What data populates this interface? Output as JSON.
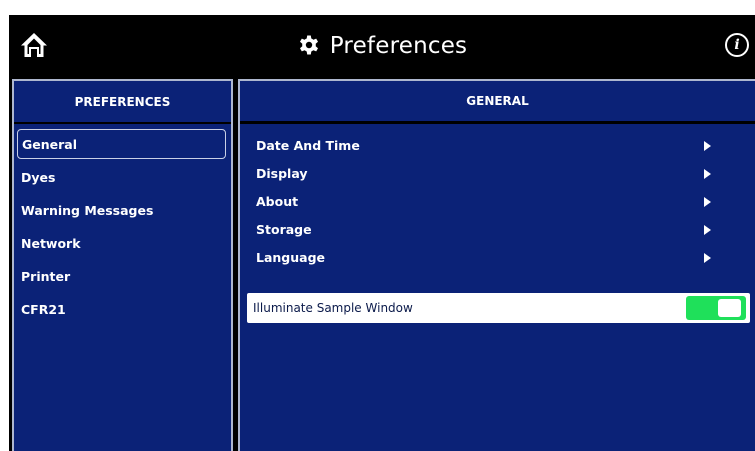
{
  "header": {
    "title": "Preferences",
    "home_icon": "home-icon",
    "settings_icon": "gear-icon",
    "info_label": "i"
  },
  "left_panel": {
    "title": "PREFERENCES",
    "items": [
      {
        "label": "General",
        "selected": true
      },
      {
        "label": "Dyes",
        "selected": false
      },
      {
        "label": "Warning Messages",
        "selected": false
      },
      {
        "label": "Network",
        "selected": false
      },
      {
        "label": "Printer",
        "selected": false
      },
      {
        "label": "CFR21",
        "selected": false
      }
    ]
  },
  "right_panel": {
    "title": "GENERAL",
    "items": [
      {
        "label": "Date And Time"
      },
      {
        "label": "Display"
      },
      {
        "label": "About"
      },
      {
        "label": "Storage"
      },
      {
        "label": "Language"
      }
    ],
    "toggle": {
      "label": "Illuminate Sample Window",
      "on": true
    }
  },
  "colors": {
    "background": "#000000",
    "panel": "#0b2277",
    "toggle_on": "#1fe05a"
  }
}
